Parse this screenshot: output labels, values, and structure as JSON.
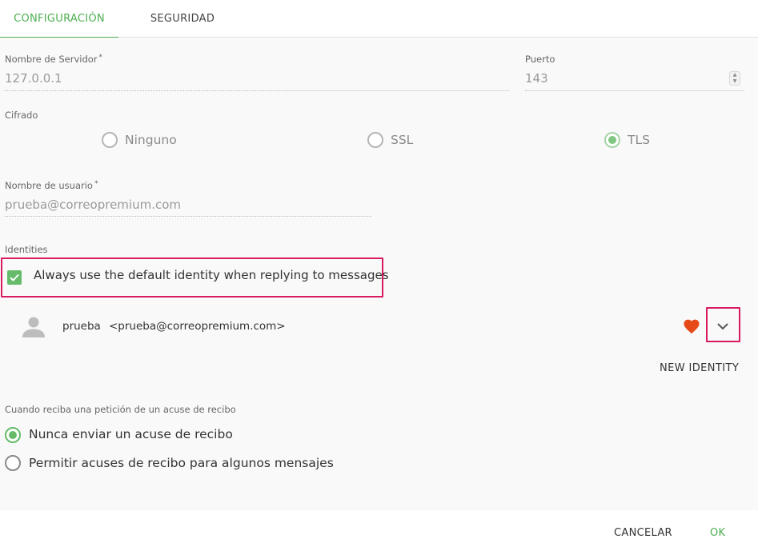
{
  "tabs": [
    {
      "label": "CONFIGURACIÓN",
      "active": true
    },
    {
      "label": "SEGURIDAD",
      "active": false
    }
  ],
  "server": {
    "label": "Nombre de Servidor",
    "required_mark": "*",
    "value": "127.0.0.1"
  },
  "port": {
    "label": "Puerto",
    "value": "143"
  },
  "encryption": {
    "label": "Cifrado",
    "options": [
      {
        "label": "Ninguno",
        "selected": false
      },
      {
        "label": "SSL",
        "selected": false
      },
      {
        "label": "TLS",
        "selected": true
      }
    ]
  },
  "username": {
    "label": "Nombre de usuario",
    "required_mark": "*",
    "value": "prueba@correopremium.com"
  },
  "identities": {
    "label": "Identities",
    "default_checkbox_label": "Always use the default identity when replying to messages",
    "default_checkbox_checked": true,
    "items": [
      {
        "name": "prueba",
        "email": "<prueba@correopremium.com>",
        "is_default": true
      }
    ],
    "new_identity_label": "NEW IDENTITY"
  },
  "receipt": {
    "label": "Cuando reciba una petición de un acuse de recibo",
    "options": [
      {
        "label": "Nunca enviar un acuse de recibo",
        "selected": true
      },
      {
        "label": "Permitir acuses de recibo para algunos mensajes",
        "selected": false
      }
    ]
  },
  "footer": {
    "cancel_label": "CANCELAR",
    "ok_label": "OK"
  },
  "colors": {
    "accent": "#4caf50",
    "highlight": "#d81b60",
    "heart": "#e64a19"
  },
  "icons": {
    "avatar": "person-icon",
    "favorite": "heart-icon",
    "expand": "chevron-down-icon"
  }
}
